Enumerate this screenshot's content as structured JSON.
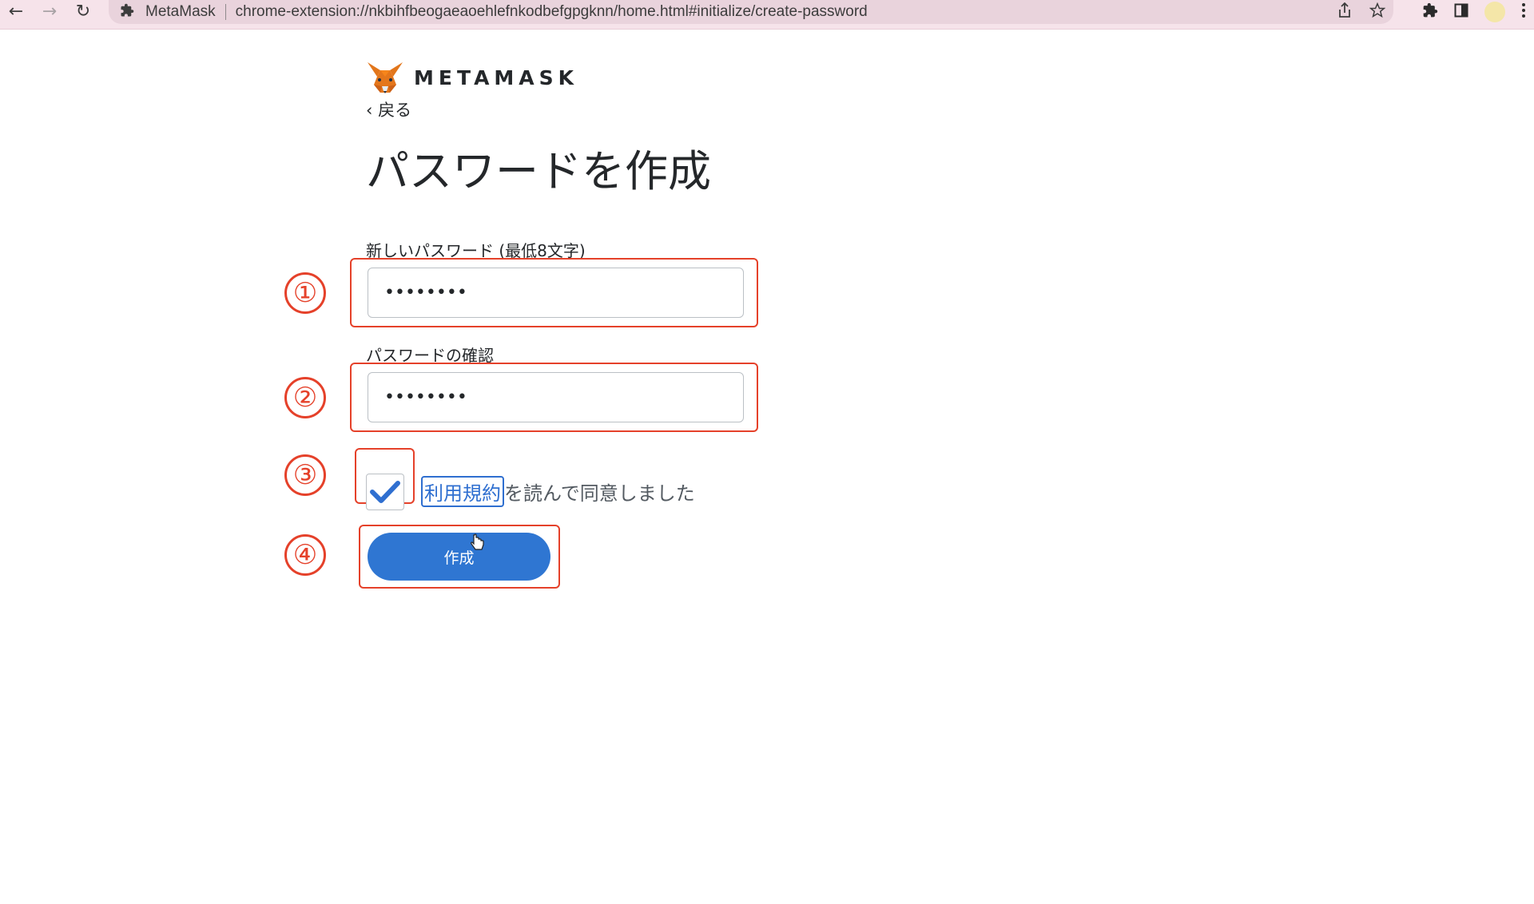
{
  "browser": {
    "back_icon": "←",
    "forward_icon": "→",
    "reload_icon": "↻",
    "site_name": "MetaMask",
    "url": "chrome-extension://nkbihfbeogaeaoehlefnkodbefgpgknn/home.html#initialize/create-password"
  },
  "logo": {
    "text": "METAMASK"
  },
  "back_link": "‹ 戻る",
  "title": "パスワードを作成",
  "new_password": {
    "label": "新しいパスワード (最低8文字)",
    "value": "••••••••"
  },
  "confirm_password": {
    "label": "パスワードの確認",
    "value": "••••••••"
  },
  "terms": {
    "checked": true,
    "link_text": "利用規約",
    "suffix_text": "を読んで同意しました"
  },
  "create_button": "作成",
  "annotations": {
    "step1": "①",
    "step2": "②",
    "step3": "③",
    "step4": "④",
    "color": "#e5412a"
  },
  "colors": {
    "accent": "#2f76d2",
    "browser_bar": "#f6e3ea"
  }
}
